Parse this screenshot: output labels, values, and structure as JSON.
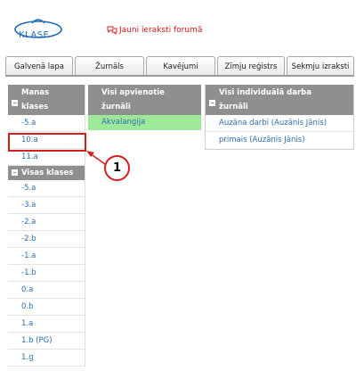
{
  "logo": {
    "text": "KLASE",
    "color": "#1f6bb5"
  },
  "forum_link": {
    "label": "Jauni ieraksti forumā",
    "icon": "speech-bubbles-icon",
    "color": "#d01818"
  },
  "tabs": [
    {
      "label": "Galvenā lapa"
    },
    {
      "label": "Žurnāls"
    },
    {
      "label": "Kavējumi"
    },
    {
      "label": "Zīmju reģistrs"
    },
    {
      "label": "Sekmju izraksti"
    }
  ],
  "classes_panel": {
    "my_header": "Manas klases",
    "my_classes": [
      "-5.a",
      "10.a",
      "11.a"
    ],
    "all_header": "Visas klases",
    "all_classes": [
      "-5.a",
      "-3.a",
      "-2.a",
      "-2.b",
      "-1.a",
      "-1.b",
      "0.a",
      "0.b",
      "1.a",
      "1.b (PG)",
      "1.g"
    ]
  },
  "joint_panel": {
    "header": "Visi apvienotie žurnāli",
    "items": [
      "Akvalangija"
    ],
    "highlight_color": "#9ee89a"
  },
  "individual_panel": {
    "header": "Visi individuālā darba žurnāli",
    "items": [
      "Auzāna darbi (Auzānis Jānis)",
      "primais (Auzānis Jānis)"
    ]
  },
  "annotation": {
    "number": "1",
    "color": "#d21f1f"
  },
  "colors": {
    "header_bg": "#8f8f8f",
    "link": "#2a6fb0"
  }
}
